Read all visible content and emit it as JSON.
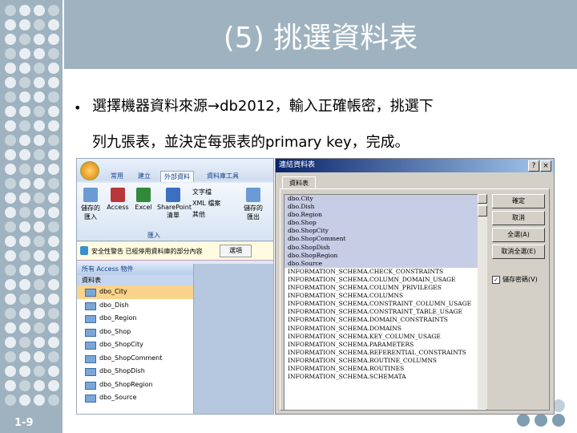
{
  "slide": {
    "title": "(5) 挑選資料表",
    "bullet_line1": "選擇機器資料來源→db2012，輸入正確帳密，挑選下",
    "bullet_line2": "列九張表，並決定每張表的primary key，完成。",
    "page_number": "1-9",
    "bullet_symbol": "•"
  },
  "access": {
    "tabs": [
      "常用",
      "建立",
      "外部資料",
      "資料庫工具"
    ],
    "active_tab_index": 2,
    "ribbon_buttons": [
      "儲存的匯入",
      "Access",
      "Excel",
      "SharePoint清單",
      "儲存的匯出"
    ],
    "small_items": [
      "文字檔",
      "XML 檔案",
      "其他"
    ],
    "group_label": "匯入",
    "security_text": "安全性警告   已經停用資料庫的部分內容",
    "security_button": "選項",
    "nav_header": "所有 Access 物件",
    "nav_section": "資料表",
    "tables": [
      "dbo_City",
      "dbo_Dish",
      "dbo_Region",
      "dbo_Shop",
      "dbo_ShopCity",
      "dbo_ShopComment",
      "dbo_ShopDish",
      "dbo_ShopRegion",
      "dbo_Source"
    ],
    "selected_table_index": 0
  },
  "dialog": {
    "title": "連結資料表",
    "tab_label": "資料表",
    "help_glyph": "?",
    "close_glyph": "×",
    "items": [
      "dbo.City",
      "dbo.Dish",
      "dbo.Region",
      "dbo.Shop",
      "dbo.ShopCity",
      "dbo.ShopComment",
      "dbo.ShopDish",
      "dbo.ShopRegion",
      "dbo.Source",
      "INFORMATION_SCHEMA.CHECK_CONSTRAINTS",
      "INFORMATION_SCHEMA.COLUMN_DOMAIN_USAGE",
      "INFORMATION_SCHEMA.COLUMN_PRIVILEGES",
      "INFORMATION_SCHEMA.COLUMNS",
      "INFORMATION_SCHEMA.CONSTRAINT_COLUMN_USAGE",
      "INFORMATION_SCHEMA.CONSTRAINT_TABLE_USAGE",
      "INFORMATION_SCHEMA.DOMAIN_CONSTRAINTS",
      "INFORMATION_SCHEMA.DOMAINS",
      "INFORMATION_SCHEMA.KEY_COLUMN_USAGE",
      "INFORMATION_SCHEMA.PARAMETERS",
      "INFORMATION_SCHEMA.REFERENTIAL_CONSTRAINTS",
      "INFORMATION_SCHEMA.ROUTINE_COLUMNS",
      "INFORMATION_SCHEMA.ROUTINES",
      "INFORMATION_SCHEMA.SCHEMATA"
    ],
    "selected_count": 9,
    "buttons": [
      "確定",
      "取消",
      "全選(A)",
      "取消全選(E)"
    ],
    "checkbox_label": "儲存密碼(V)",
    "checkbox_checked": true
  }
}
